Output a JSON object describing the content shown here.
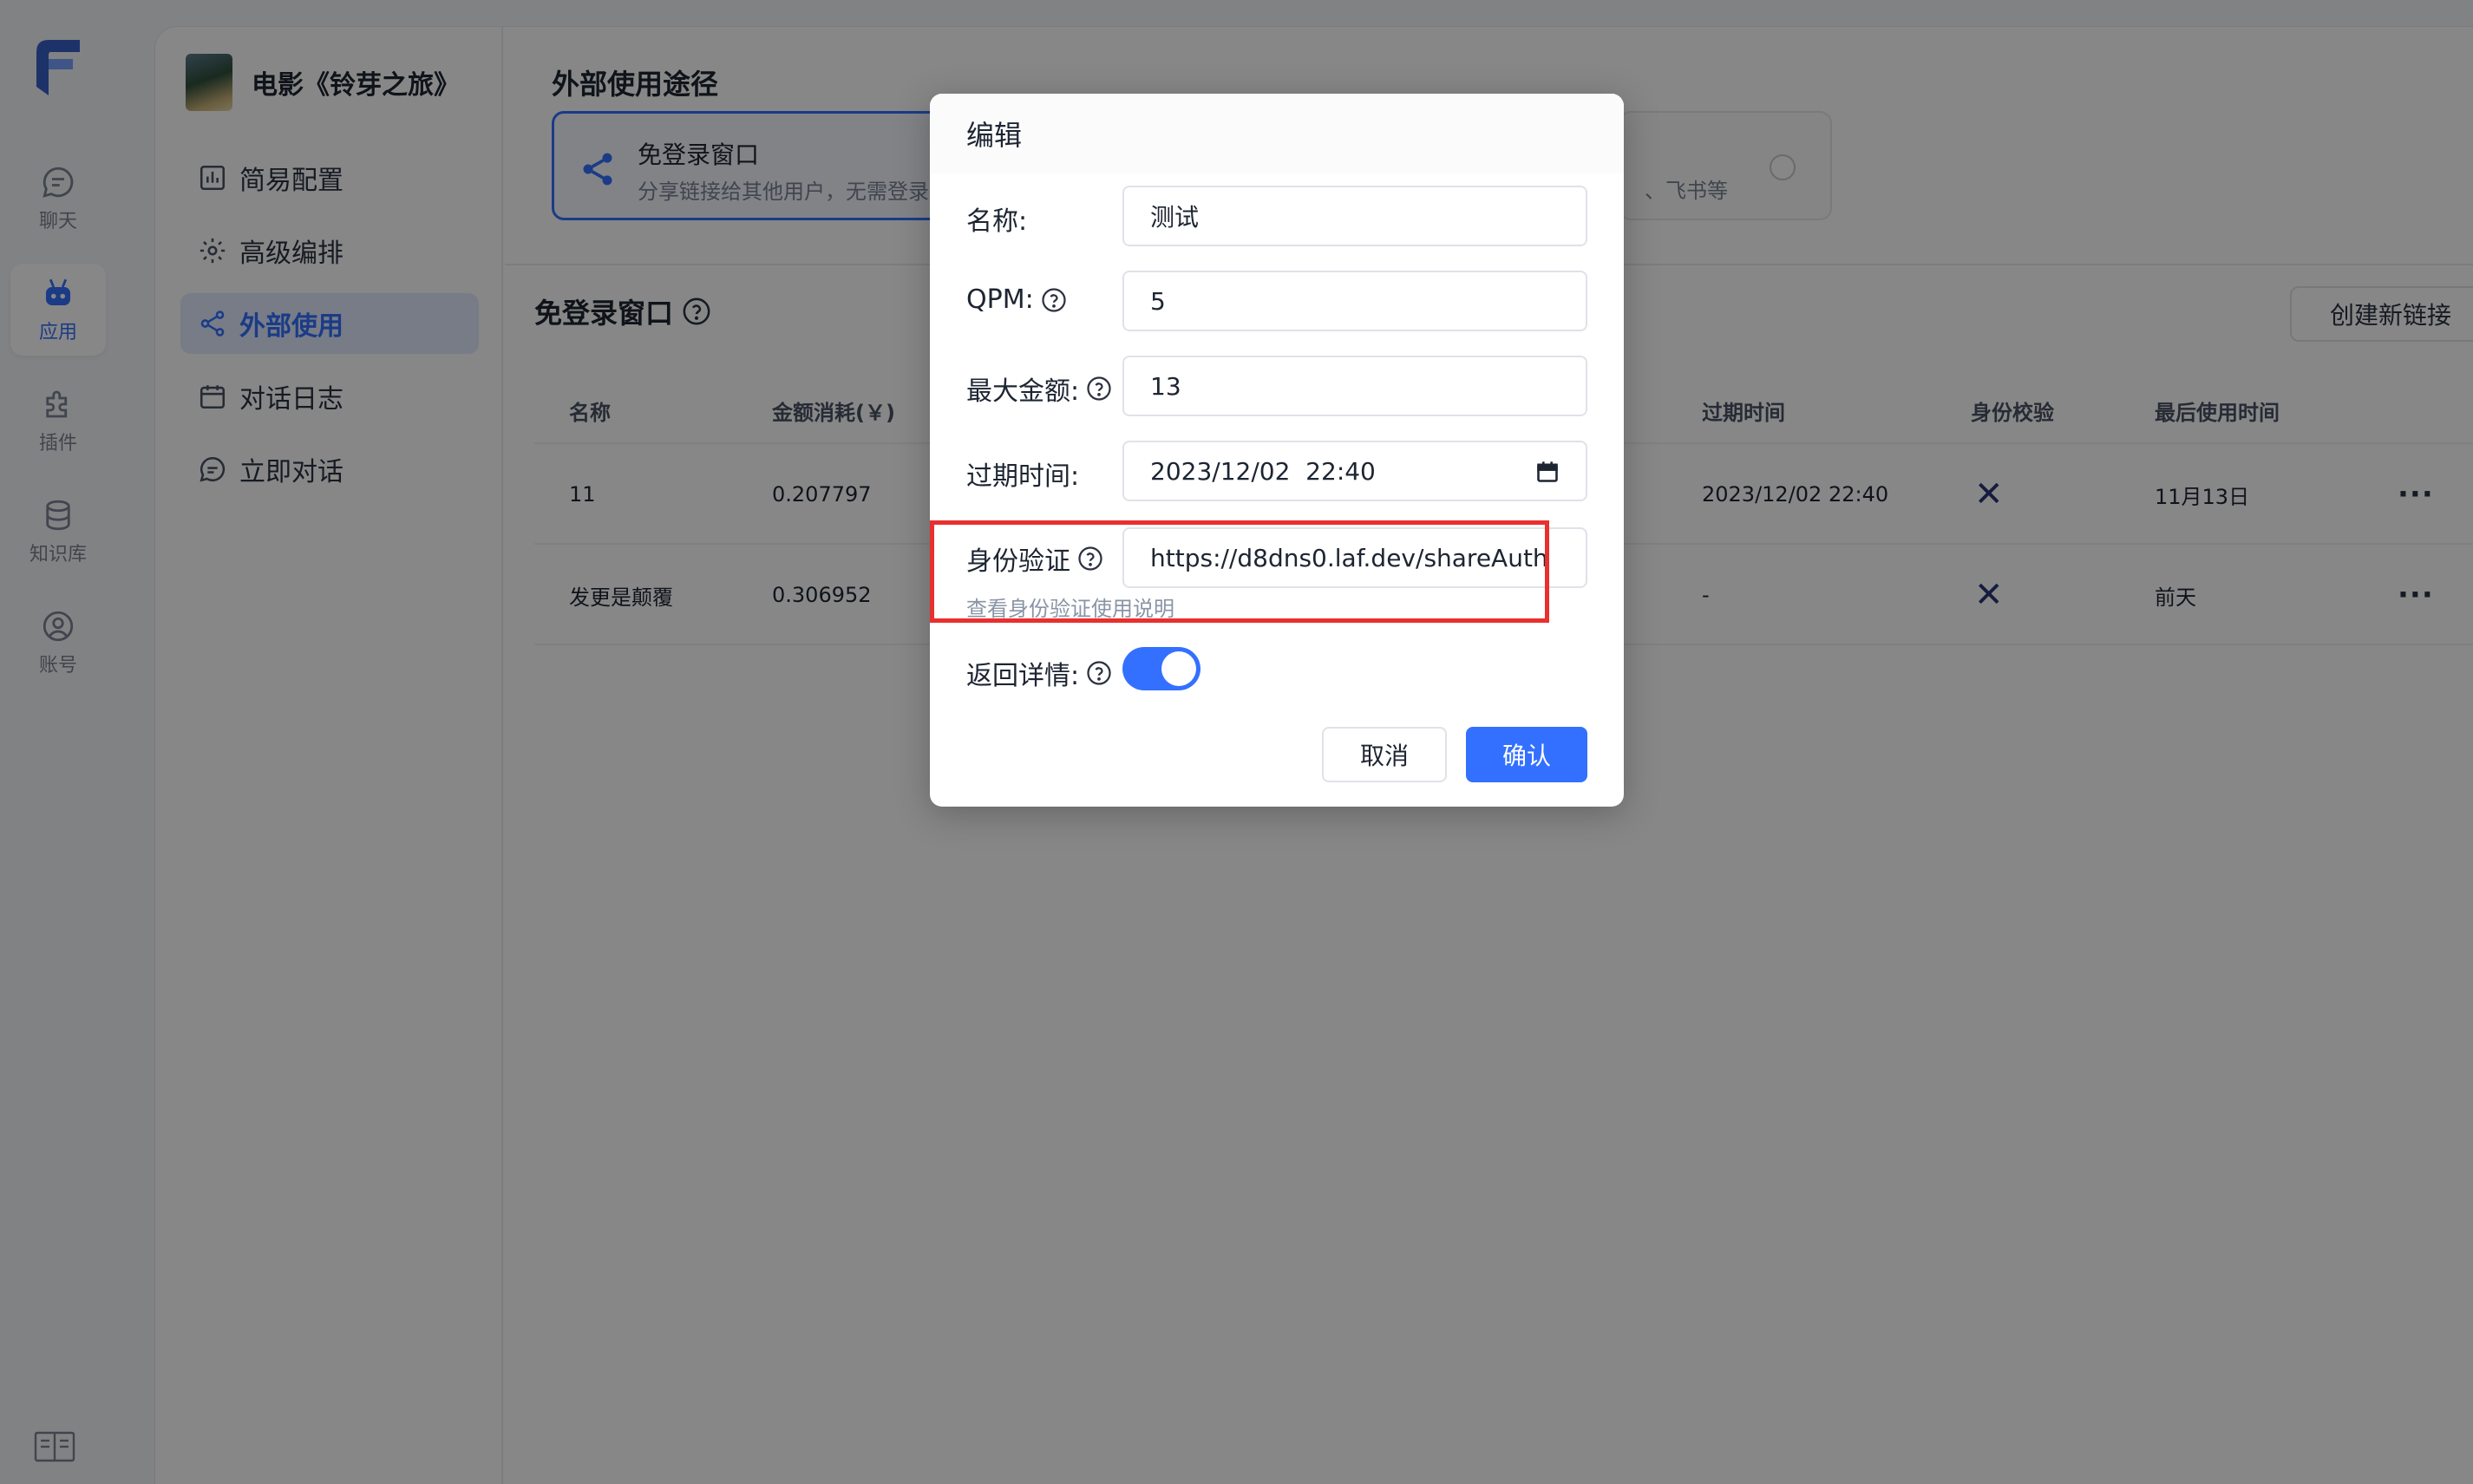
{
  "nav": {
    "items": [
      {
        "label": "聊天",
        "icon": "chat-icon"
      },
      {
        "label": "应用",
        "icon": "robot-icon",
        "active": true
      },
      {
        "label": "插件",
        "icon": "puzzle-icon"
      },
      {
        "label": "知识库",
        "icon": "database-icon"
      },
      {
        "label": "账号",
        "icon": "user-icon"
      }
    ]
  },
  "app": {
    "name": "电影《铃芽之旅》",
    "menu": [
      {
        "label": "简易配置",
        "icon": "chart-icon"
      },
      {
        "label": "高级编排",
        "icon": "gear-icon"
      },
      {
        "label": "外部使用",
        "icon": "share-icon",
        "active": true
      },
      {
        "label": "对话日志",
        "icon": "calendar-icon"
      },
      {
        "label": "立即对话",
        "icon": "chat-icon"
      }
    ]
  },
  "main": {
    "section_title": "外部使用途径",
    "option_no_login": {
      "title": "免登录窗口",
      "desc": "分享链接给其他用户，无需登录"
    },
    "option_other_desc": "、飞书等",
    "list_title": "免登录窗口",
    "create_button": "创建新链接",
    "table": {
      "headers": [
        "名称",
        "金额消耗(￥)",
        "过期时间",
        "身份校验",
        "最后使用时间"
      ],
      "rows": [
        {
          "name": "11",
          "cost": "0.207797",
          "expire": "2023/12/02 22:40",
          "last_used": "11月13日"
        },
        {
          "name": "发更是颠覆",
          "cost": "0.306952",
          "expire": "-",
          "last_used": "前天"
        }
      ]
    }
  },
  "modal": {
    "title": "编辑",
    "name_label": "名称:",
    "name_value": "测试",
    "qpm_label": "QPM:",
    "qpm_value": "5",
    "max_amount_label": "最大金额:",
    "max_amount_value": "13",
    "expire_label": "过期时间:",
    "expire_value": "2023/12/02  22:40",
    "auth_label": "身份验证",
    "auth_value": "https://d8dns0.laf.dev/shareAuth",
    "auth_hint": "查看身份验证使用说明",
    "detail_label": "返回详情:",
    "detail_enabled": true,
    "cancel": "取消",
    "confirm": "确认"
  },
  "colors": {
    "accent": "#3370ff",
    "highlight": "#e8302e"
  }
}
